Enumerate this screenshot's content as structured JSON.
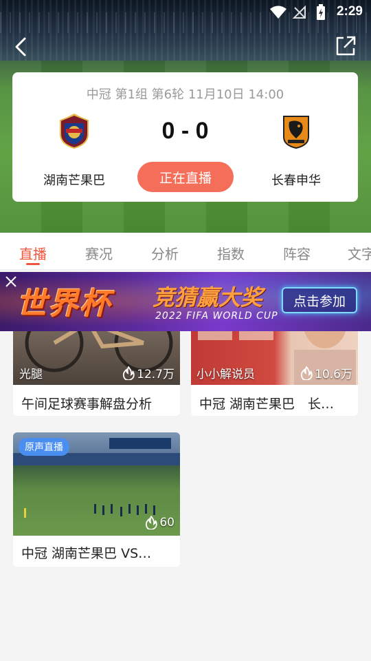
{
  "status_bar": {
    "time": "2:29"
  },
  "match": {
    "info": "中冠 第1组 第6轮  11月10日 14:00",
    "score": "0 - 0",
    "home_team": "湖南芒果巴",
    "away_team": "长春申华",
    "live_button": "正在直播"
  },
  "tabs": [
    {
      "label": "直播"
    },
    {
      "label": "赛况"
    },
    {
      "label": "分析"
    },
    {
      "label": "指数"
    },
    {
      "label": "阵容"
    },
    {
      "label": "文字"
    }
  ],
  "promo": {
    "title": "世界杯",
    "subtitle": "竞猜赢大奖",
    "tagline": "2022 FIFA WORLD CUP",
    "button": "点击参加"
  },
  "videos": [
    {
      "author": "光腿",
      "views": "12.7万",
      "title": "午间足球赛事解盘分析"
    },
    {
      "author": "小小解说员",
      "views": "10.6万",
      "title": "中冠 湖南芒果巴　长…"
    },
    {
      "badge": "原声直播",
      "views": "60",
      "title": "中冠 湖南芒果巴 VS…"
    }
  ],
  "colors": {
    "accent": "#f0553f",
    "live_button": "#f46e5a",
    "badge": "#4a8ef0"
  }
}
